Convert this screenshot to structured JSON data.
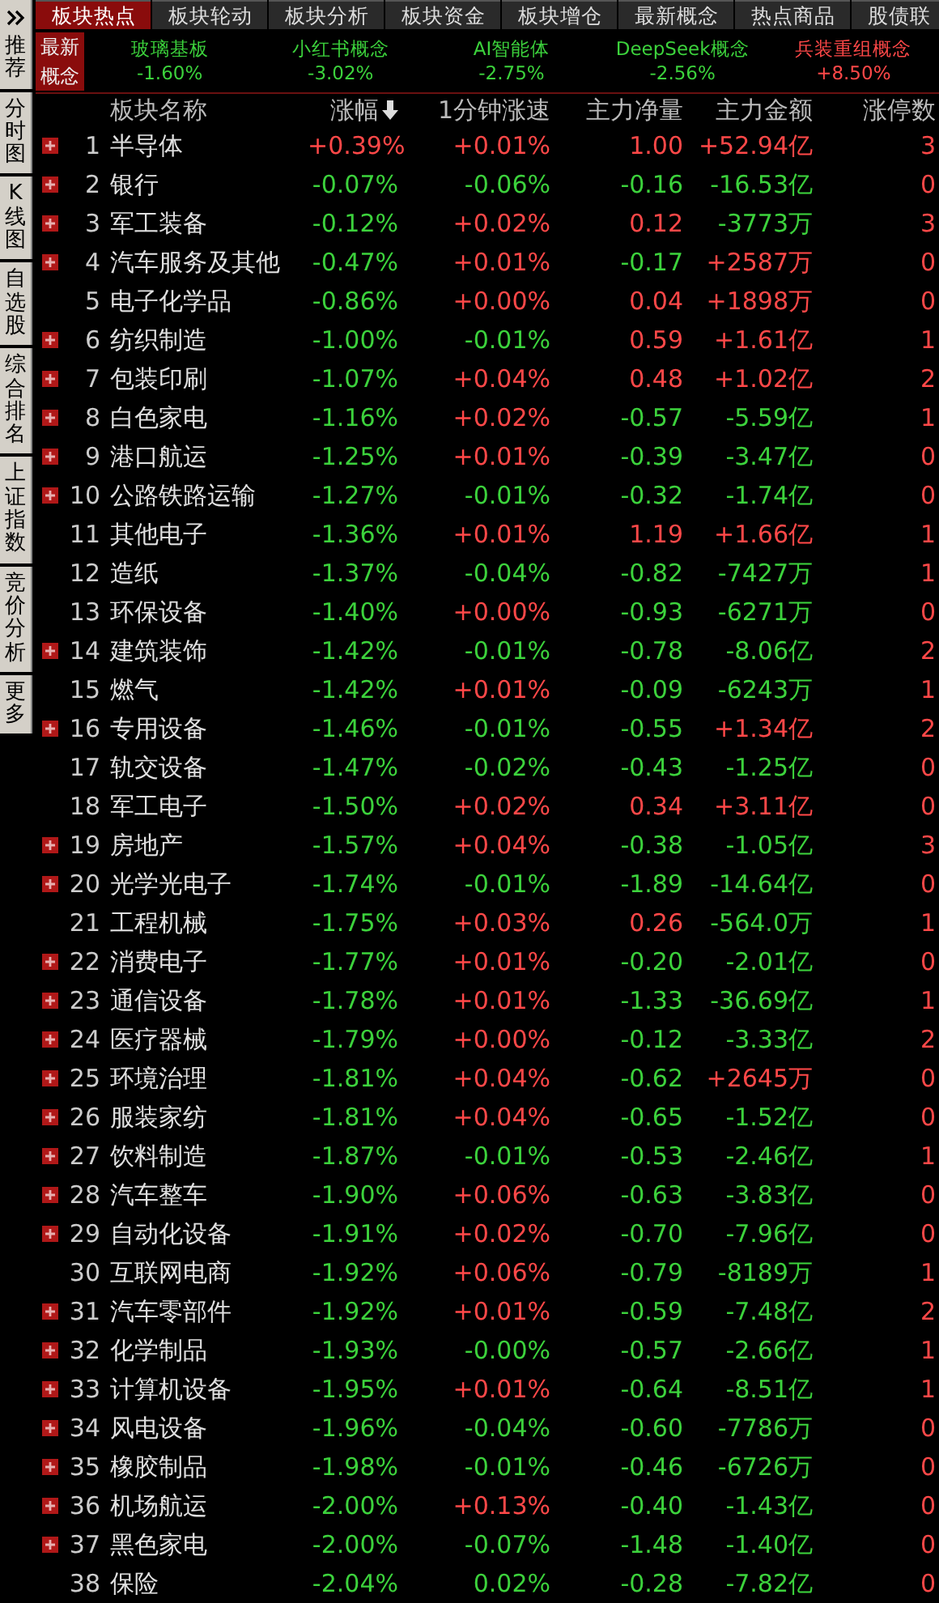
{
  "sidebar": {
    "items": [
      {
        "label": "推荐",
        "collapse": true
      },
      {
        "label": "分时图",
        "collapse": false
      },
      {
        "label": "K线图",
        "collapse": false
      },
      {
        "label": "自选股",
        "collapse": false
      },
      {
        "label": "综合排名",
        "collapse": false
      },
      {
        "label": "上证指数",
        "collapse": false
      },
      {
        "label": "竞价分析",
        "collapse": false
      },
      {
        "label": "更多",
        "collapse": false
      }
    ]
  },
  "tabs": [
    {
      "label": "板块热点",
      "selected": true
    },
    {
      "label": "板块轮动",
      "selected": false
    },
    {
      "label": "板块分析",
      "selected": false
    },
    {
      "label": "板块资金",
      "selected": false
    },
    {
      "label": "板块增仓",
      "selected": false
    },
    {
      "label": "最新概念",
      "selected": false
    },
    {
      "label": "热点商品",
      "selected": false
    },
    {
      "label": "股债联",
      "selected": false
    }
  ],
  "concepts": {
    "label": "最新概念",
    "items": [
      {
        "name": "玻璃基板",
        "pct": "-1.60%",
        "up": false
      },
      {
        "name": "小红书概念",
        "pct": "-3.02%",
        "up": false
      },
      {
        "name": "AI智能体",
        "pct": "-2.75%",
        "up": false
      },
      {
        "name": "DeepSeek概念",
        "pct": "-2.56%",
        "up": false
      },
      {
        "name": "兵装重组概念",
        "pct": "+8.50%",
        "up": true
      }
    ]
  },
  "table": {
    "columns": [
      {
        "label": "板块名称",
        "sorted": false
      },
      {
        "label": "涨幅",
        "sorted": true
      },
      {
        "label": "1分钟涨速",
        "sorted": false
      },
      {
        "label": "主力净量",
        "sorted": false
      },
      {
        "label": "主力金额",
        "sorted": false
      },
      {
        "label": "涨停数",
        "sorted": false
      }
    ],
    "rows": [
      {
        "rank": "1",
        "name": "半导体",
        "expandable": true,
        "change": "+0.39%",
        "change_up": true,
        "speed": "+0.01%",
        "speed_up": true,
        "net": "1.00",
        "net_up": true,
        "amount": "+52.94亿",
        "amount_up": true,
        "limit": "3"
      },
      {
        "rank": "2",
        "name": "银行",
        "expandable": true,
        "change": "-0.07%",
        "change_up": false,
        "speed": "-0.06%",
        "speed_up": false,
        "net": "-0.16",
        "net_up": false,
        "amount": "-16.53亿",
        "amount_up": false,
        "limit": "0"
      },
      {
        "rank": "3",
        "name": "军工装备",
        "expandable": true,
        "change": "-0.12%",
        "change_up": false,
        "speed": "+0.02%",
        "speed_up": true,
        "net": "0.12",
        "net_up": true,
        "amount": "-3773万",
        "amount_up": false,
        "limit": "3"
      },
      {
        "rank": "4",
        "name": "汽车服务及其他",
        "expandable": true,
        "change": "-0.47%",
        "change_up": false,
        "speed": "+0.01%",
        "speed_up": true,
        "net": "-0.17",
        "net_up": false,
        "amount": "+2587万",
        "amount_up": true,
        "limit": "0"
      },
      {
        "rank": "5",
        "name": "电子化学品",
        "expandable": false,
        "change": "-0.86%",
        "change_up": false,
        "speed": "+0.00%",
        "speed_up": true,
        "net": "0.04",
        "net_up": true,
        "amount": "+1898万",
        "amount_up": true,
        "limit": "0"
      },
      {
        "rank": "6",
        "name": "纺织制造",
        "expandable": true,
        "change": "-1.00%",
        "change_up": false,
        "speed": "-0.01%",
        "speed_up": false,
        "net": "0.59",
        "net_up": true,
        "amount": "+1.61亿",
        "amount_up": true,
        "limit": "1"
      },
      {
        "rank": "7",
        "name": "包装印刷",
        "expandable": true,
        "change": "-1.07%",
        "change_up": false,
        "speed": "+0.04%",
        "speed_up": true,
        "net": "0.48",
        "net_up": true,
        "amount": "+1.02亿",
        "amount_up": true,
        "limit": "2"
      },
      {
        "rank": "8",
        "name": "白色家电",
        "expandable": true,
        "change": "-1.16%",
        "change_up": false,
        "speed": "+0.02%",
        "speed_up": true,
        "net": "-0.57",
        "net_up": false,
        "amount": "-5.59亿",
        "amount_up": false,
        "limit": "1"
      },
      {
        "rank": "9",
        "name": "港口航运",
        "expandable": true,
        "change": "-1.25%",
        "change_up": false,
        "speed": "+0.01%",
        "speed_up": true,
        "net": "-0.39",
        "net_up": false,
        "amount": "-3.47亿",
        "amount_up": false,
        "limit": "0"
      },
      {
        "rank": "10",
        "name": "公路铁路运输",
        "expandable": true,
        "change": "-1.27%",
        "change_up": false,
        "speed": "-0.01%",
        "speed_up": false,
        "net": "-0.32",
        "net_up": false,
        "amount": "-1.74亿",
        "amount_up": false,
        "limit": "0"
      },
      {
        "rank": "11",
        "name": "其他电子",
        "expandable": false,
        "change": "-1.36%",
        "change_up": false,
        "speed": "+0.01%",
        "speed_up": true,
        "net": "1.19",
        "net_up": true,
        "amount": "+1.66亿",
        "amount_up": true,
        "limit": "1"
      },
      {
        "rank": "12",
        "name": "造纸",
        "expandable": false,
        "change": "-1.37%",
        "change_up": false,
        "speed": "-0.04%",
        "speed_up": false,
        "net": "-0.82",
        "net_up": false,
        "amount": "-7427万",
        "amount_up": false,
        "limit": "1"
      },
      {
        "rank": "13",
        "name": "环保设备",
        "expandable": false,
        "change": "-1.40%",
        "change_up": false,
        "speed": "+0.00%",
        "speed_up": true,
        "net": "-0.93",
        "net_up": false,
        "amount": "-6271万",
        "amount_up": false,
        "limit": "0"
      },
      {
        "rank": "14",
        "name": "建筑装饰",
        "expandable": true,
        "change": "-1.42%",
        "change_up": false,
        "speed": "-0.01%",
        "speed_up": false,
        "net": "-0.78",
        "net_up": false,
        "amount": "-8.06亿",
        "amount_up": false,
        "limit": "2"
      },
      {
        "rank": "15",
        "name": "燃气",
        "expandable": false,
        "change": "-1.42%",
        "change_up": false,
        "speed": "+0.01%",
        "speed_up": true,
        "net": "-0.09",
        "net_up": false,
        "amount": "-6243万",
        "amount_up": false,
        "limit": "1"
      },
      {
        "rank": "16",
        "name": "专用设备",
        "expandable": true,
        "change": "-1.46%",
        "change_up": false,
        "speed": "-0.01%",
        "speed_up": false,
        "net": "-0.55",
        "net_up": false,
        "amount": "+1.34亿",
        "amount_up": true,
        "limit": "2"
      },
      {
        "rank": "17",
        "name": "轨交设备",
        "expandable": false,
        "change": "-1.47%",
        "change_up": false,
        "speed": "-0.02%",
        "speed_up": false,
        "net": "-0.43",
        "net_up": false,
        "amount": "-1.25亿",
        "amount_up": false,
        "limit": "0"
      },
      {
        "rank": "18",
        "name": "军工电子",
        "expandable": false,
        "change": "-1.50%",
        "change_up": false,
        "speed": "+0.02%",
        "speed_up": true,
        "net": "0.34",
        "net_up": true,
        "amount": "+3.11亿",
        "amount_up": true,
        "limit": "0"
      },
      {
        "rank": "19",
        "name": "房地产",
        "expandable": true,
        "change": "-1.57%",
        "change_up": false,
        "speed": "+0.04%",
        "speed_up": true,
        "net": "-0.38",
        "net_up": false,
        "amount": "-1.05亿",
        "amount_up": false,
        "limit": "3"
      },
      {
        "rank": "20",
        "name": "光学光电子",
        "expandable": true,
        "change": "-1.74%",
        "change_up": false,
        "speed": "-0.01%",
        "speed_up": false,
        "net": "-1.89",
        "net_up": false,
        "amount": "-14.64亿",
        "amount_up": false,
        "limit": "0"
      },
      {
        "rank": "21",
        "name": "工程机械",
        "expandable": false,
        "change": "-1.75%",
        "change_up": false,
        "speed": "+0.03%",
        "speed_up": true,
        "net": "0.26",
        "net_up": true,
        "amount": "-564.0万",
        "amount_up": false,
        "limit": "1"
      },
      {
        "rank": "22",
        "name": "消费电子",
        "expandable": true,
        "change": "-1.77%",
        "change_up": false,
        "speed": "+0.01%",
        "speed_up": true,
        "net": "-0.20",
        "net_up": false,
        "amount": "-2.01亿",
        "amount_up": false,
        "limit": "0"
      },
      {
        "rank": "23",
        "name": "通信设备",
        "expandable": true,
        "change": "-1.78%",
        "change_up": false,
        "speed": "+0.01%",
        "speed_up": true,
        "net": "-1.33",
        "net_up": false,
        "amount": "-36.69亿",
        "amount_up": false,
        "limit": "1"
      },
      {
        "rank": "24",
        "name": "医疗器械",
        "expandable": true,
        "change": "-1.79%",
        "change_up": false,
        "speed": "+0.00%",
        "speed_up": true,
        "net": "-0.12",
        "net_up": false,
        "amount": "-3.33亿",
        "amount_up": false,
        "limit": "2"
      },
      {
        "rank": "25",
        "name": "环境治理",
        "expandable": true,
        "change": "-1.81%",
        "change_up": false,
        "speed": "+0.04%",
        "speed_up": true,
        "net": "-0.62",
        "net_up": false,
        "amount": "+2645万",
        "amount_up": true,
        "limit": "0"
      },
      {
        "rank": "26",
        "name": "服装家纺",
        "expandable": true,
        "change": "-1.81%",
        "change_up": false,
        "speed": "+0.04%",
        "speed_up": true,
        "net": "-0.65",
        "net_up": false,
        "amount": "-1.52亿",
        "amount_up": false,
        "limit": "0"
      },
      {
        "rank": "27",
        "name": "饮料制造",
        "expandable": true,
        "change": "-1.87%",
        "change_up": false,
        "speed": "-0.01%",
        "speed_up": false,
        "net": "-0.53",
        "net_up": false,
        "amount": "-2.46亿",
        "amount_up": false,
        "limit": "1"
      },
      {
        "rank": "28",
        "name": "汽车整车",
        "expandable": true,
        "change": "-1.90%",
        "change_up": false,
        "speed": "+0.06%",
        "speed_up": true,
        "net": "-0.63",
        "net_up": false,
        "amount": "-3.83亿",
        "amount_up": false,
        "limit": "0"
      },
      {
        "rank": "29",
        "name": "自动化设备",
        "expandable": true,
        "change": "-1.91%",
        "change_up": false,
        "speed": "+0.02%",
        "speed_up": true,
        "net": "-0.70",
        "net_up": false,
        "amount": "-7.96亿",
        "amount_up": false,
        "limit": "0"
      },
      {
        "rank": "30",
        "name": "互联网电商",
        "expandable": false,
        "change": "-1.92%",
        "change_up": false,
        "speed": "+0.06%",
        "speed_up": true,
        "net": "-0.79",
        "net_up": false,
        "amount": "-8189万",
        "amount_up": false,
        "limit": "1"
      },
      {
        "rank": "31",
        "name": "汽车零部件",
        "expandable": true,
        "change": "-1.92%",
        "change_up": false,
        "speed": "+0.01%",
        "speed_up": true,
        "net": "-0.59",
        "net_up": false,
        "amount": "-7.48亿",
        "amount_up": false,
        "limit": "2"
      },
      {
        "rank": "32",
        "name": "化学制品",
        "expandable": true,
        "change": "-1.93%",
        "change_up": false,
        "speed": "-0.00%",
        "speed_up": false,
        "net": "-0.57",
        "net_up": false,
        "amount": "-2.66亿",
        "amount_up": false,
        "limit": "1"
      },
      {
        "rank": "33",
        "name": "计算机设备",
        "expandable": true,
        "change": "-1.95%",
        "change_up": false,
        "speed": "+0.01%",
        "speed_up": true,
        "net": "-0.64",
        "net_up": false,
        "amount": "-8.51亿",
        "amount_up": false,
        "limit": "1"
      },
      {
        "rank": "34",
        "name": "风电设备",
        "expandable": true,
        "change": "-1.96%",
        "change_up": false,
        "speed": "-0.04%",
        "speed_up": false,
        "net": "-0.60",
        "net_up": false,
        "amount": "-7786万",
        "amount_up": false,
        "limit": "0"
      },
      {
        "rank": "35",
        "name": "橡胶制品",
        "expandable": true,
        "change": "-1.98%",
        "change_up": false,
        "speed": "-0.01%",
        "speed_up": false,
        "net": "-0.46",
        "net_up": false,
        "amount": "-6726万",
        "amount_up": false,
        "limit": "0"
      },
      {
        "rank": "36",
        "name": "机场航运",
        "expandable": true,
        "change": "-2.00%",
        "change_up": false,
        "speed": "+0.13%",
        "speed_up": true,
        "net": "-0.40",
        "net_up": false,
        "amount": "-1.43亿",
        "amount_up": false,
        "limit": "0"
      },
      {
        "rank": "37",
        "name": "黑色家电",
        "expandable": true,
        "change": "-2.00%",
        "change_up": false,
        "speed": "-0.07%",
        "speed_up": false,
        "net": "-1.48",
        "net_up": false,
        "amount": "-1.40亿",
        "amount_up": false,
        "limit": "0"
      },
      {
        "rank": "38",
        "name": "保险",
        "expandable": false,
        "change": "-2.04%",
        "change_up": false,
        "speed": "0.02%",
        "speed_up": false,
        "net": "-0.28",
        "net_up": false,
        "amount": "-7.82亿",
        "amount_up": false,
        "limit": "0"
      }
    ]
  }
}
